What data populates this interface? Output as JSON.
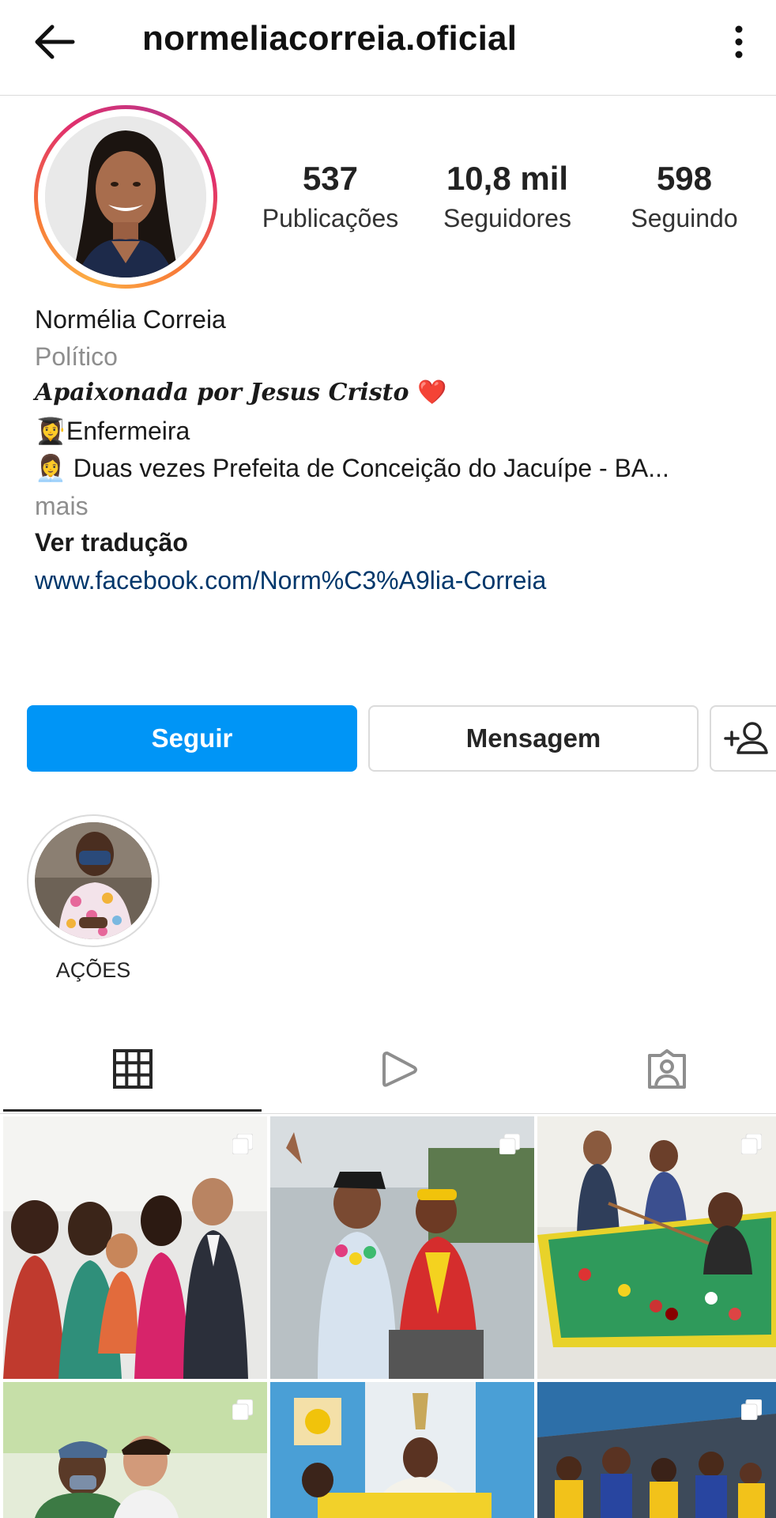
{
  "header": {
    "title": "normeliacorreia.oficial",
    "back_icon": "arrow-left-icon",
    "menu_icon": "more-vertical-icon"
  },
  "stats": {
    "posts_value": "537",
    "posts_label": "Publicações",
    "followers_value": "10,8 mil",
    "followers_label": "Seguidores",
    "following_value": "598",
    "following_label": "Seguindo"
  },
  "bio": {
    "name": "Normélia Correia",
    "category": "Político",
    "tagline": "Apaixonada por Jesus Cristo",
    "tagline_emoji": "❤️",
    "line1_emoji": "👩‍🎓",
    "line1": "Enfermeira",
    "line2_emoji": "👩‍💼",
    "line2": " Duas vezes Prefeita de Conceição do Jacuípe - BA...",
    "more": "mais",
    "translate": "Ver tradução",
    "link": "www.facebook.com/Norm%C3%A9lia-Correia"
  },
  "actions": {
    "follow": "Seguir",
    "message": "Mensagem",
    "add_user_icon": "add-user-icon"
  },
  "highlights": [
    {
      "label": "AÇÕES"
    }
  ],
  "tabs": [
    {
      "icon": "grid-icon",
      "active": true
    },
    {
      "icon": "reels-play-icon",
      "active": false
    },
    {
      "icon": "tagged-person-icon",
      "active": false
    }
  ],
  "colors": {
    "accent": "#0095f6",
    "link": "#00376b",
    "secondary_text": "#8e8e8e",
    "border": "#dbdbdb"
  }
}
